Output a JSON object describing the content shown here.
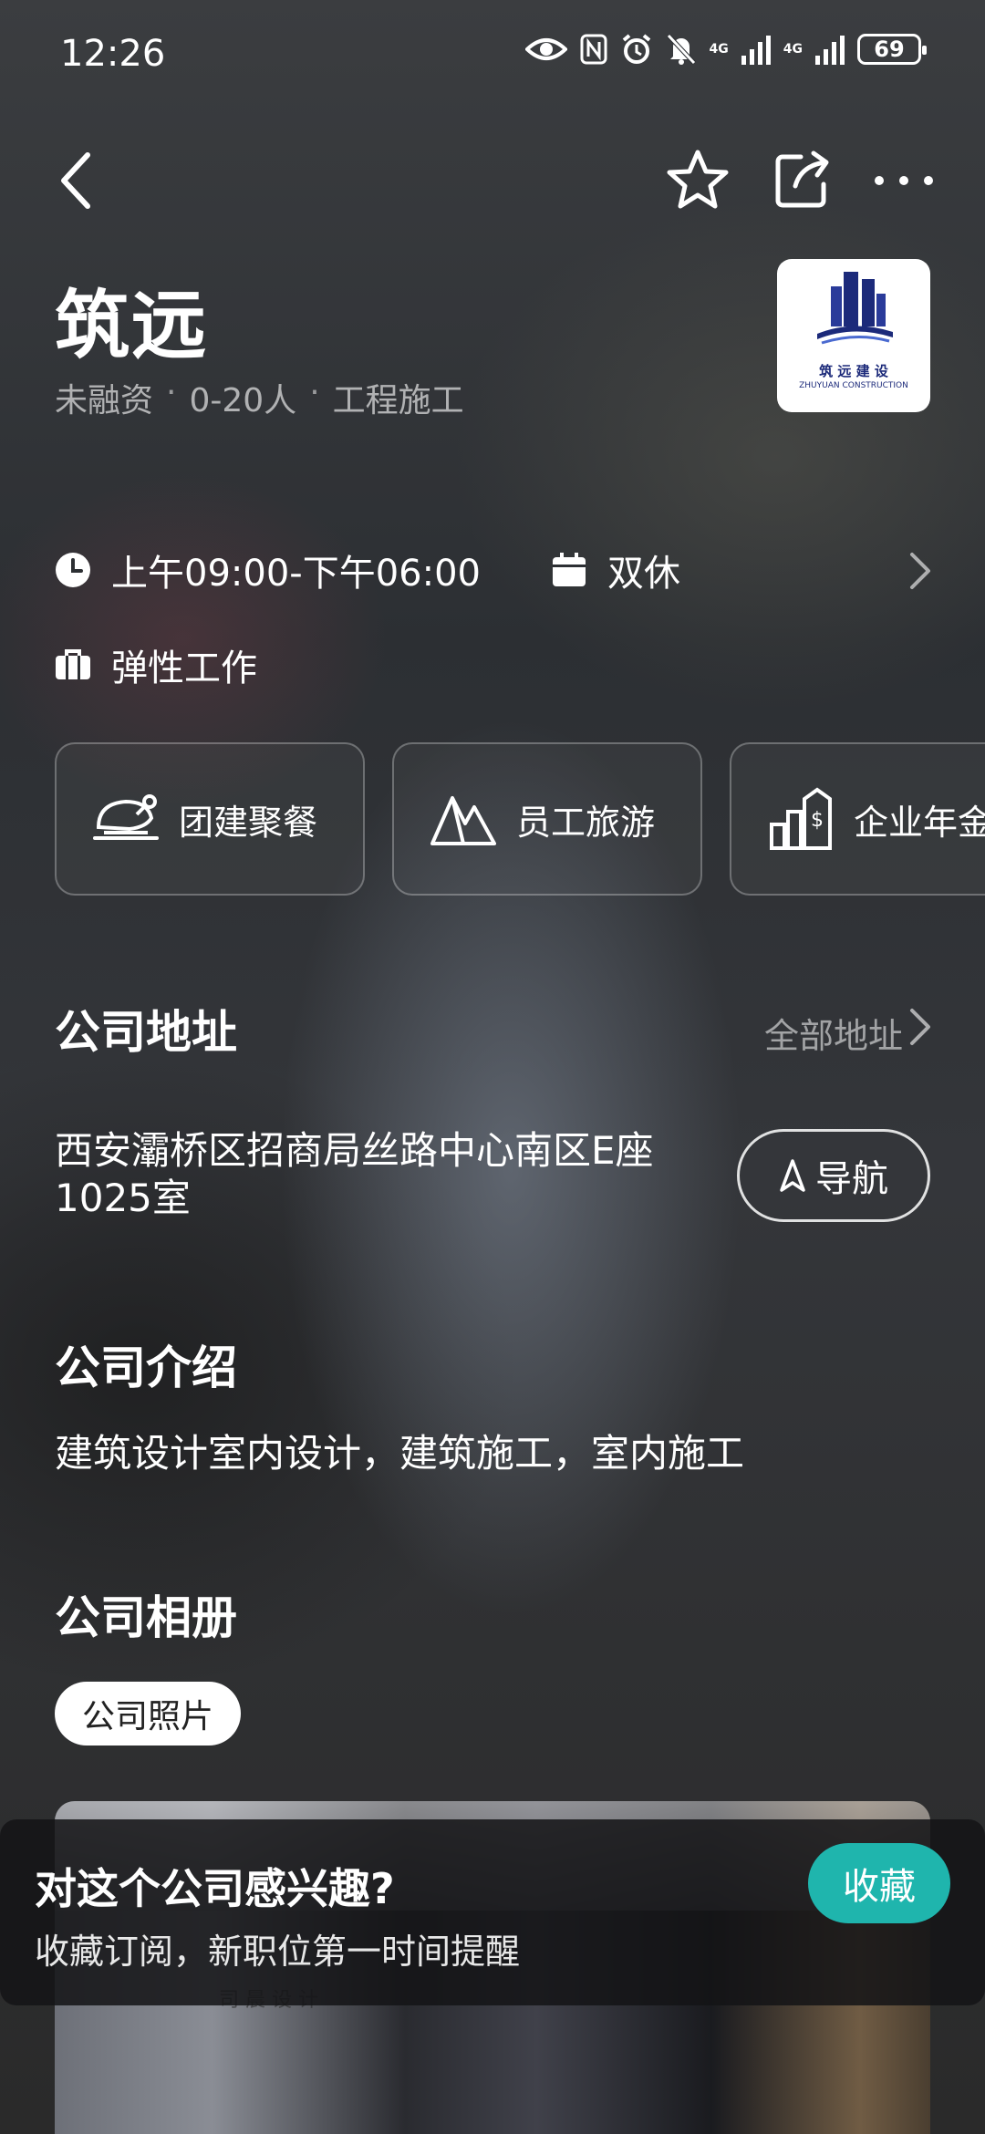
{
  "status_bar": {
    "time": "12:26",
    "battery": "69",
    "network_1": "4G",
    "network_2": "4G"
  },
  "header": {
    "back_icon": "chevron-left-icon",
    "favorite_icon": "star-icon",
    "share_icon": "share-icon",
    "more_icon": "more-icon"
  },
  "company": {
    "name": "筑远",
    "funding": "未融资",
    "size": "0-20人",
    "industry": "工程施工",
    "logo_cn": "筑 远 建 设",
    "logo_en": "ZHUYUAN CONSTRUCTION"
  },
  "work_info": {
    "hours": "上午09:00-下午06:00",
    "rest": "双休",
    "mode": "弹性工作"
  },
  "benefits": [
    {
      "label": "团建聚餐",
      "icon": "dinner-icon"
    },
    {
      "label": "员工旅游",
      "icon": "mountain-icon"
    },
    {
      "label": "企业年金",
      "icon": "pension-icon"
    }
  ],
  "address_section": {
    "title": "公司地址",
    "see_all": "全部地址",
    "address": "西安灞桥区招商局丝路中心南区E座1025室",
    "nav_label": "导航"
  },
  "intro_section": {
    "title": "公司介绍",
    "text": "建筑设计室内设计，建筑施工，室内施工"
  },
  "album_section": {
    "title": "公司相册",
    "chip": "公司照片",
    "photo_sign": "司 晨 设 计"
  },
  "subscribe_banner": {
    "title": "对这个公司感兴趣?",
    "subtitle": "收藏订阅，新职位第一时间提醒",
    "button": "收藏"
  },
  "colors": {
    "accent": "#1fb5ad",
    "logo_blue": "#1c2a7a"
  }
}
